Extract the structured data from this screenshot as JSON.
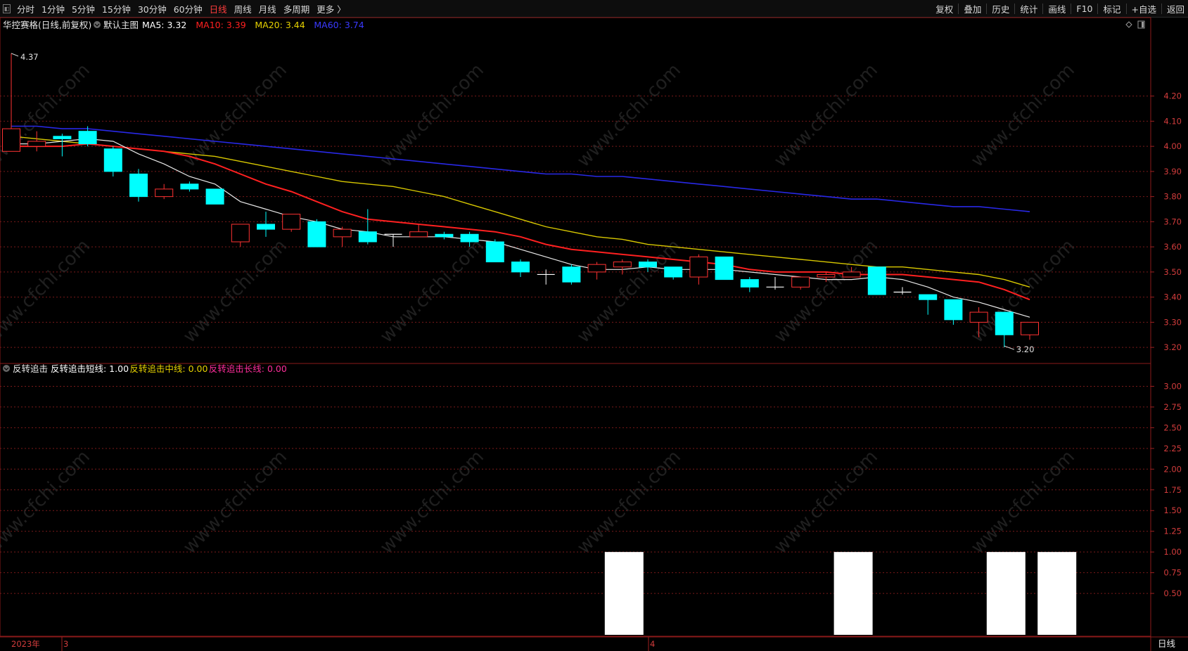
{
  "toolbar": {
    "left_items": [
      "分时",
      "1分钟",
      "5分钟",
      "15分钟",
      "30分钟",
      "60分钟",
      "日线",
      "周线",
      "月线",
      "多周期",
      "更多 〉"
    ],
    "active": "日线",
    "right_items": [
      "复权",
      "叠加",
      "历史",
      "统计",
      "画线",
      "F10",
      "标记",
      "+自选",
      "返回"
    ]
  },
  "main_panel": {
    "title": "华控赛格(日线,前复权)",
    "template": "默认主图",
    "ma_legend": [
      {
        "label": "MA5: 3.32",
        "color": "#ffffff"
      },
      {
        "label": "MA10: 3.39",
        "color": "#ff2020"
      },
      {
        "label": "MA20: 3.44",
        "color": "#e6d200"
      },
      {
        "label": "MA60: 3.74",
        "color": "#2f2fff"
      }
    ],
    "high_label": "4.37",
    "low_label": "3.20",
    "y_ticks": [
      "4.20",
      "4.10",
      "4.00",
      "3.90",
      "3.80",
      "3.70",
      "3.60",
      "3.50",
      "3.40",
      "3.30",
      "3.20"
    ],
    "ylim": [
      3.15,
      4.42
    ]
  },
  "indicator_panel": {
    "title": "反转追击",
    "legend": [
      {
        "label": "反转追击短线: 1.00",
        "color": "#ffffff"
      },
      {
        "label": "反转追击中线: 0.00",
        "color": "#e6d200"
      },
      {
        "label": "反转追击长线: 0.00",
        "color": "#ff2d9b"
      }
    ],
    "y_ticks": [
      "3.00",
      "2.75",
      "2.50",
      "2.25",
      "2.00",
      "1.75",
      "1.50",
      "1.25",
      "1.00",
      "0.75",
      "0.50"
    ],
    "ylim": [
      0,
      3.25
    ]
  },
  "date_axis": {
    "year_label": "2023年",
    "month_labels": [
      "3",
      "4"
    ]
  },
  "period_badge": "日线",
  "watermark": "www.cfchi.com",
  "chart_data": {
    "type": "candlestick",
    "candles": [
      {
        "o": 3.98,
        "c": 4.07,
        "h": 4.37,
        "l": 3.98
      },
      {
        "o": 4.0,
        "c": 4.02,
        "h": 4.06,
        "l": 3.98
      },
      {
        "o": 4.04,
        "c": 4.03,
        "h": 4.05,
        "l": 3.96
      },
      {
        "o": 4.06,
        "c": 4.01,
        "h": 4.08,
        "l": 4.0
      },
      {
        "o": 3.99,
        "c": 3.9,
        "h": 4.0,
        "l": 3.88
      },
      {
        "o": 3.89,
        "c": 3.8,
        "h": 3.91,
        "l": 3.78
      },
      {
        "o": 3.8,
        "c": 3.83,
        "h": 3.85,
        "l": 3.79
      },
      {
        "o": 3.85,
        "c": 3.83,
        "h": 3.86,
        "l": 3.82
      },
      {
        "o": 3.83,
        "c": 3.77,
        "h": 3.83,
        "l": 3.77
      },
      {
        "o": 3.62,
        "c": 3.69,
        "h": 3.69,
        "l": 3.6
      },
      {
        "o": 3.69,
        "c": 3.67,
        "h": 3.74,
        "l": 3.64
      },
      {
        "o": 3.67,
        "c": 3.73,
        "h": 3.73,
        "l": 3.66
      },
      {
        "o": 3.7,
        "c": 3.6,
        "h": 3.71,
        "l": 3.6
      },
      {
        "o": 3.64,
        "c": 3.67,
        "h": 3.68,
        "l": 3.6
      },
      {
        "o": 3.66,
        "c": 3.62,
        "h": 3.75,
        "l": 3.61
      },
      {
        "o": 3.65,
        "c": 3.65,
        "h": 3.65,
        "l": 3.6
      },
      {
        "o": 3.64,
        "c": 3.66,
        "h": 3.69,
        "l": 3.64
      },
      {
        "o": 3.65,
        "c": 3.64,
        "h": 3.66,
        "l": 3.63
      },
      {
        "o": 3.65,
        "c": 3.62,
        "h": 3.66,
        "l": 3.6
      },
      {
        "o": 3.62,
        "c": 3.54,
        "h": 3.63,
        "l": 3.54
      },
      {
        "o": 3.54,
        "c": 3.5,
        "h": 3.55,
        "l": 3.48
      },
      {
        "o": 3.49,
        "c": 3.49,
        "h": 3.51,
        "l": 3.45
      },
      {
        "o": 3.52,
        "c": 3.46,
        "h": 3.53,
        "l": 3.45
      },
      {
        "o": 3.5,
        "c": 3.53,
        "h": 3.54,
        "l": 3.47
      },
      {
        "o": 3.52,
        "c": 3.54,
        "h": 3.55,
        "l": 3.49
      },
      {
        "o": 3.54,
        "c": 3.52,
        "h": 3.55,
        "l": 3.5
      },
      {
        "o": 3.52,
        "c": 3.48,
        "h": 3.52,
        "l": 3.47
      },
      {
        "o": 3.48,
        "c": 3.56,
        "h": 3.57,
        "l": 3.45
      },
      {
        "o": 3.56,
        "c": 3.47,
        "h": 3.56,
        "l": 3.47
      },
      {
        "o": 3.47,
        "c": 3.44,
        "h": 3.48,
        "l": 3.42
      },
      {
        "o": 3.44,
        "c": 3.44,
        "h": 3.48,
        "l": 3.43
      },
      {
        "o": 3.44,
        "c": 3.48,
        "h": 3.48,
        "l": 3.43
      },
      {
        "o": 3.48,
        "c": 3.49,
        "h": 3.5,
        "l": 3.46
      },
      {
        "o": 3.48,
        "c": 3.5,
        "h": 3.52,
        "l": 3.48
      },
      {
        "o": 3.52,
        "c": 3.41,
        "h": 3.52,
        "l": 3.41
      },
      {
        "o": 3.42,
        "c": 3.42,
        "h": 3.44,
        "l": 3.41
      },
      {
        "o": 3.41,
        "c": 3.39,
        "h": 3.41,
        "l": 3.33
      },
      {
        "o": 3.39,
        "c": 3.31,
        "h": 3.39,
        "l": 3.29
      },
      {
        "o": 3.3,
        "c": 3.34,
        "h": 3.36,
        "l": 3.24
      },
      {
        "o": 3.34,
        "c": 3.25,
        "h": 3.34,
        "l": 3.2
      },
      {
        "o": 3.25,
        "c": 3.3,
        "h": 3.3,
        "l": 3.23
      }
    ],
    "ma5": [
      4.01,
      4.01,
      4.02,
      4.03,
      4.02,
      3.97,
      3.93,
      3.88,
      3.85,
      3.78,
      3.75,
      3.72,
      3.7,
      3.67,
      3.66,
      3.64,
      3.64,
      3.64,
      3.63,
      3.62,
      3.59,
      3.56,
      3.53,
      3.51,
      3.51,
      3.52,
      3.51,
      3.51,
      3.51,
      3.5,
      3.49,
      3.48,
      3.47,
      3.47,
      3.48,
      3.47,
      3.44,
      3.4,
      3.38,
      3.35,
      3.32
    ],
    "ma10": [
      4.0,
      4.0,
      4.0,
      4.01,
      4.0,
      3.99,
      3.98,
      3.96,
      3.93,
      3.89,
      3.85,
      3.82,
      3.78,
      3.74,
      3.71,
      3.7,
      3.69,
      3.68,
      3.67,
      3.66,
      3.64,
      3.61,
      3.59,
      3.58,
      3.57,
      3.56,
      3.55,
      3.54,
      3.53,
      3.51,
      3.5,
      3.5,
      3.5,
      3.49,
      3.49,
      3.49,
      3.48,
      3.47,
      3.46,
      3.43,
      3.39
    ],
    "ma20": [
      4.04,
      4.03,
      4.02,
      4.01,
      4.0,
      3.99,
      3.98,
      3.97,
      3.96,
      3.94,
      3.92,
      3.9,
      3.88,
      3.86,
      3.85,
      3.84,
      3.82,
      3.8,
      3.77,
      3.74,
      3.71,
      3.68,
      3.66,
      3.64,
      3.63,
      3.61,
      3.6,
      3.59,
      3.58,
      3.57,
      3.56,
      3.55,
      3.54,
      3.53,
      3.52,
      3.52,
      3.51,
      3.5,
      3.49,
      3.47,
      3.44
    ],
    "ma60": [
      4.08,
      4.08,
      4.07,
      4.07,
      4.06,
      4.05,
      4.04,
      4.03,
      4.02,
      4.01,
      4.0,
      3.99,
      3.98,
      3.97,
      3.96,
      3.95,
      3.94,
      3.93,
      3.92,
      3.91,
      3.9,
      3.89,
      3.89,
      3.88,
      3.88,
      3.87,
      3.86,
      3.85,
      3.84,
      3.83,
      3.82,
      3.81,
      3.8,
      3.79,
      3.79,
      3.78,
      3.77,
      3.76,
      3.76,
      3.75,
      3.74
    ],
    "signal_bars": [
      {
        "index": 24,
        "value": 1.0
      },
      {
        "index": 33,
        "value": 1.0
      },
      {
        "index": 39,
        "value": 1.0
      },
      {
        "index": 41,
        "value": 1.0
      }
    ],
    "colors": {
      "up": "#ff3232",
      "down": "#00ffff",
      "doji": "#ffffff"
    }
  }
}
